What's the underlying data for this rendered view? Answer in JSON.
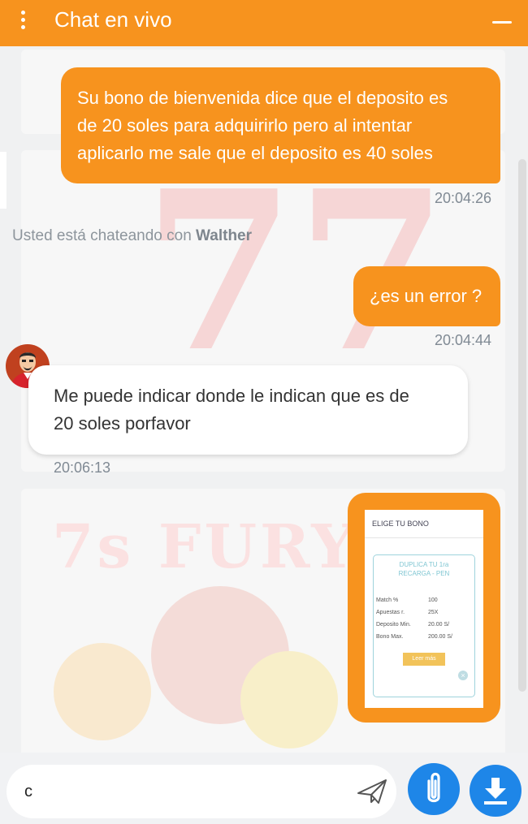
{
  "header": {
    "title": "Chat en vivo"
  },
  "background": {
    "big_seven": "77",
    "game_title": "7s FURY"
  },
  "messages": [
    {
      "kind": "outgoing",
      "lines": [
        "Su bono de bienvenida dice que el deposito es",
        "de 20 soles para adquirirlo pero al intentar",
        "aplicarlo me sale que el deposito es 40 soles"
      ],
      "time": "20:04:26"
    },
    {
      "kind": "system",
      "prefix": "Usted está chateando con",
      "agent": "Walther"
    },
    {
      "kind": "outgoing",
      "lines": [
        "¿es un error ?"
      ],
      "time": "20:04:44"
    },
    {
      "kind": "incoming",
      "lines": [
        "Me puede indicar donde le indican que es de",
        "20 soles porfavor"
      ],
      "time": "20:06:13"
    }
  ],
  "attachment": {
    "heading": "ELIGE TU BONO",
    "card_title_1": "DUPLICA TU 1ra",
    "card_title_2": "RECARGA - PEN",
    "rows": [
      {
        "label": "Match %",
        "value": "100"
      },
      {
        "label": "Apuestas r.",
        "value": "25X"
      },
      {
        "label": "Deposito Min.",
        "value": "20.00 S/"
      },
      {
        "label": "Bono Max.",
        "value": "200.00 S/"
      }
    ],
    "button": "Leer más"
  },
  "composer": {
    "value": "c"
  },
  "colors": {
    "accent": "#f7931e",
    "blue": "#1e86e8",
    "agent_shirt": "#c0411f"
  }
}
